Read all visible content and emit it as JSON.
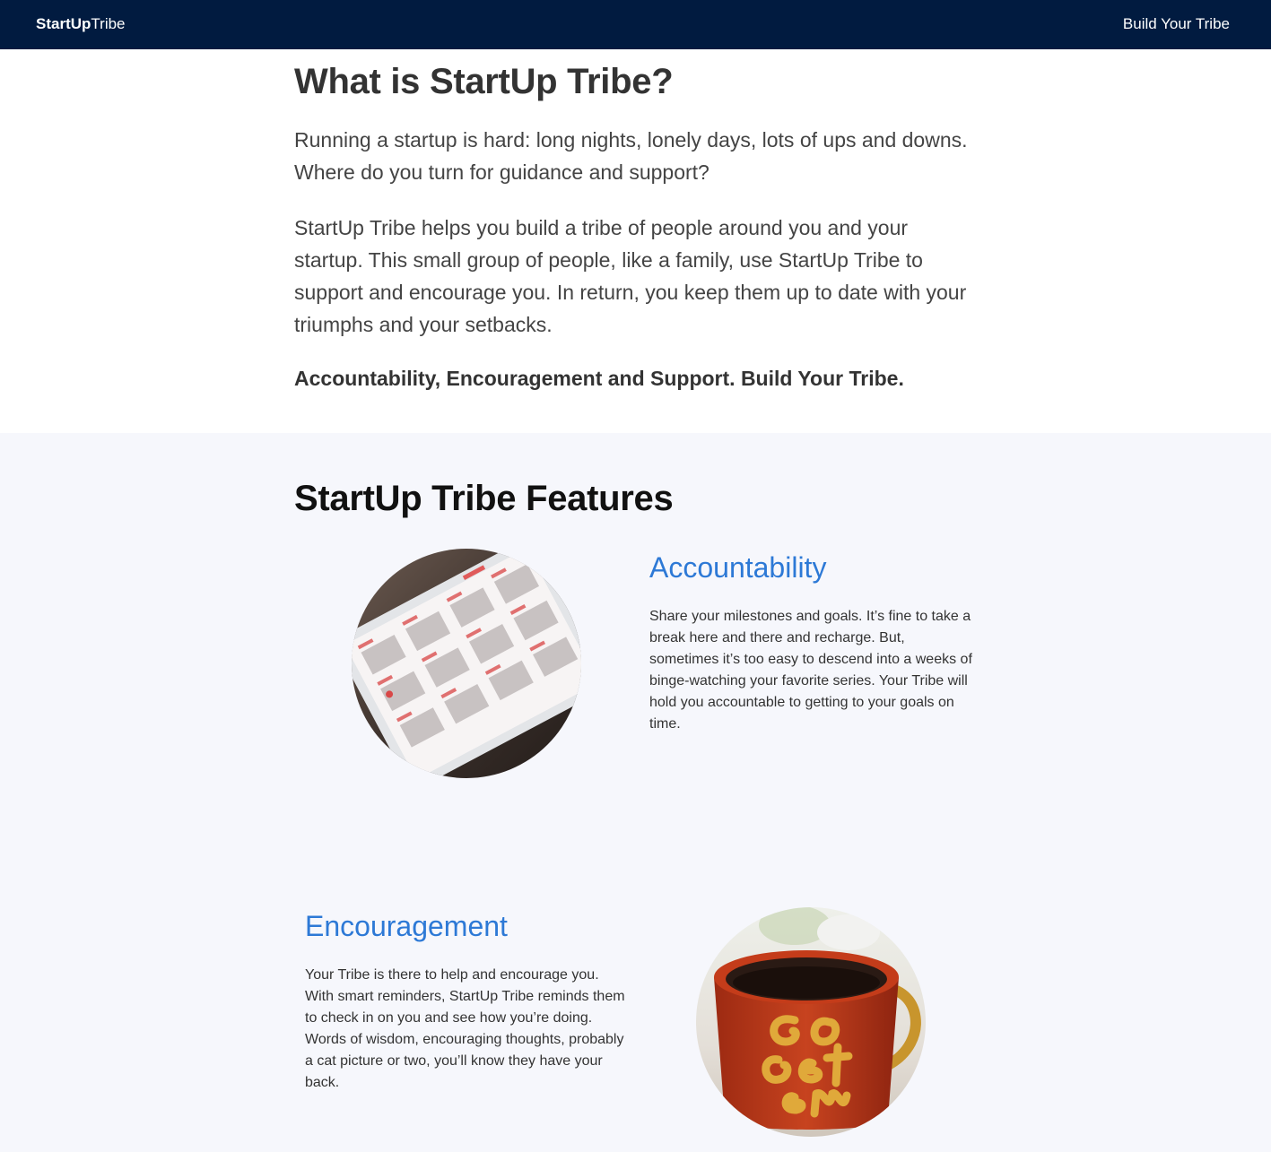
{
  "nav": {
    "brand_bold": "StartUp",
    "brand_light": "Tribe",
    "link": "Build Your Tribe"
  },
  "about": {
    "title": "What is StartUp Tribe?",
    "paragraph1": "Running a startup is hard: long nights, lonely days, lots of ups and downs. Where do you turn for guidance and support?",
    "paragraph2": "StartUp Tribe helps you build a tribe of people around you and your startup. This small group of people, like a family, use StartUp Tribe to support and encourage you. In return, you keep them up to date with your triumphs and your setbacks.",
    "tagline": "Accountability, Encouragement and Support. Build Your Tribe."
  },
  "features": {
    "title": "StartUp Tribe Features",
    "items": [
      {
        "title": "Accountability",
        "text": "Share your milestones and goals. It’s fine to take a break here and there and recharge. But, sometimes it’s too easy to descend into a weeks of binge-watching your favorite series. Your Tribe will hold you accountable to getting to your goals on time.",
        "image": "tablet-calendar-photo"
      },
      {
        "title": "Encouragement",
        "text": "Your Tribe is there to help and encourage you. With smart reminders, StartUp Tribe reminds them to check in on you and see how you’re doing. Words of wisdom, encouraging thoughts, probably a cat picture or two, you’ll know they have your back.",
        "image": "coffee-mug-photo",
        "mug_lettering": "go get 'em"
      }
    ]
  }
}
